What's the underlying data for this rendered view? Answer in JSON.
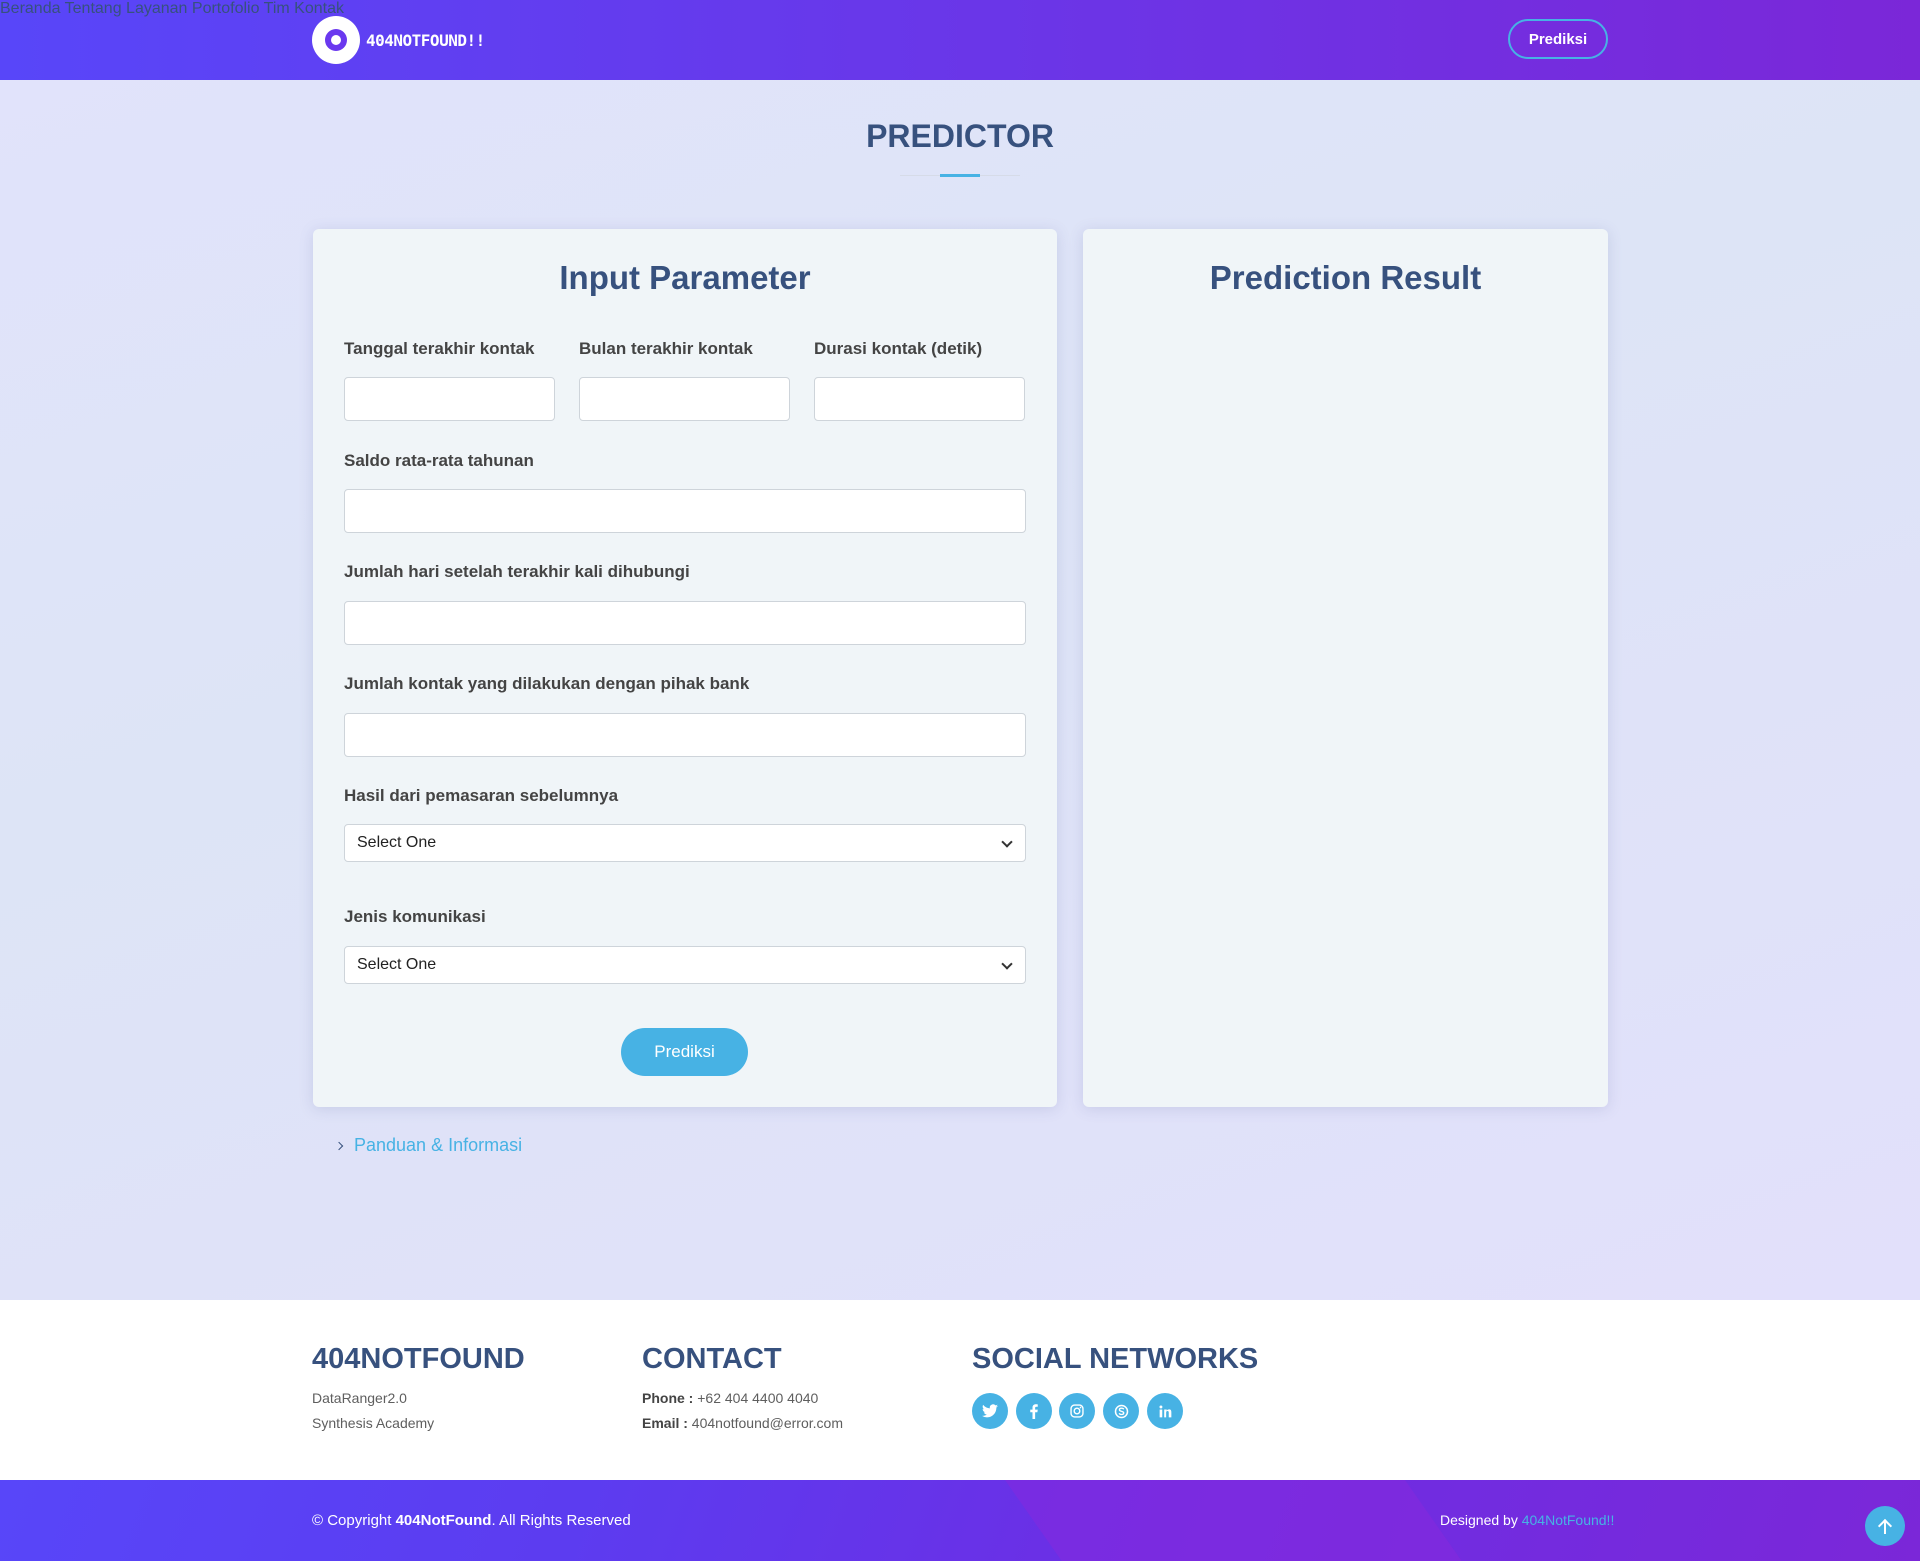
{
  "header": {
    "logo_text": "404NOTFOUND!!",
    "nav": [
      "Beranda",
      "Tentang",
      "Layanan",
      "Portofolio",
      "Tim",
      "Kontak"
    ],
    "cta": "Prediksi"
  },
  "section_title": "PREDICTOR",
  "input_card": {
    "title": "Input Parameter",
    "fields": [
      {
        "label": "Tanggal terakhir kontak",
        "value": ""
      },
      {
        "label": "Bulan terakhir kontak",
        "value": ""
      },
      {
        "label": "Durasi kontak (detik)",
        "value": ""
      },
      {
        "label": "Saldo rata-rata tahunan",
        "value": ""
      },
      {
        "label": "Jumlah hari setelah terakhir kali dihubungi",
        "value": ""
      },
      {
        "label": "Jumlah kontak yang dilakukan dengan pihak bank",
        "value": ""
      }
    ],
    "selects": [
      {
        "label": "Hasil dari pemasaran sebelumnya",
        "selected": "Select One"
      },
      {
        "label": "Jenis komunikasi",
        "selected": "Select One"
      }
    ],
    "submit_label": "Prediksi"
  },
  "result_card": {
    "title": "Prediction Result"
  },
  "guide_link": "Panduan & Informasi",
  "footer": {
    "brand": {
      "title": "404NOTFOUND",
      "line1": "DataRanger2.0",
      "line2": "Synthesis Academy"
    },
    "contact": {
      "title": "CONTACT",
      "phone_label": "Phone :",
      "phone": "+62 404 4400 4040",
      "email_label": "Email :",
      "email": "404notfound@error.com"
    },
    "social": {
      "title": "SOCIAL NETWORKS",
      "icons": [
        "twitter-icon",
        "facebook-icon",
        "instagram-icon",
        "skype-icon",
        "linkedin-icon"
      ]
    },
    "copyright_prefix": "© Copyright",
    "copyright_brand": "404NotFound",
    "copyright_suffix": ". All Rights Reserved",
    "designed_prefix": "Designed by",
    "designed_brand": "404NotFound!!"
  },
  "colors": {
    "accent": "#47b2e4",
    "gradient_start": "#5846f9",
    "gradient_end": "#7b27d8",
    "heading": "#37517e"
  }
}
